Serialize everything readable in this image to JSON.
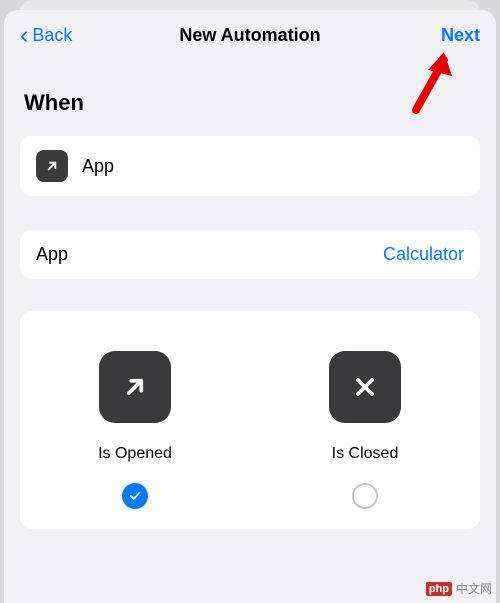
{
  "nav": {
    "back_label": "Back",
    "title": "New Automation",
    "next_label": "Next"
  },
  "when": {
    "section_title": "When",
    "trigger_label": "App"
  },
  "app_picker": {
    "label": "App",
    "value": "Calculator"
  },
  "options": {
    "opened": {
      "label": "Is Opened",
      "selected": true
    },
    "closed": {
      "label": "Is Closed",
      "selected": false
    }
  },
  "watermark": "中文网"
}
